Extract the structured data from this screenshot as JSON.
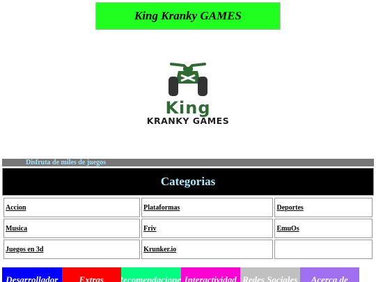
{
  "header": {
    "title": "King Kranky GAMES"
  },
  "logo": {
    "word_top": "King",
    "word_bottom": "Kranky Games"
  },
  "tagline": "Disfruta de miles de juegos",
  "categories": {
    "title": "Categorias",
    "rows": [
      [
        "Accion",
        "Plataformas",
        "Deportes"
      ],
      [
        "Musica",
        "Friv",
        "EmuOs"
      ],
      [
        "Juegos en 3d",
        "Krunker.io",
        ""
      ]
    ]
  },
  "nav": {
    "items": [
      {
        "label": "Desarrollador",
        "color": "#0000ff"
      },
      {
        "label": "Extras",
        "color": "#ff0000"
      },
      {
        "label": "Recomendaciones",
        "color": "#00ff80"
      },
      {
        "label": "Interactividad",
        "color": "#ff00d4"
      },
      {
        "label": "Redes Sociales",
        "color": "#c0c0c0"
      },
      {
        "label": "Acerca de",
        "color": "#a070f0"
      }
    ]
  },
  "colors": {
    "title_bg": "#21ff21",
    "logo_green": "#2e6b33",
    "categories_bg": "#000000",
    "categories_text": "#a8ecff"
  }
}
